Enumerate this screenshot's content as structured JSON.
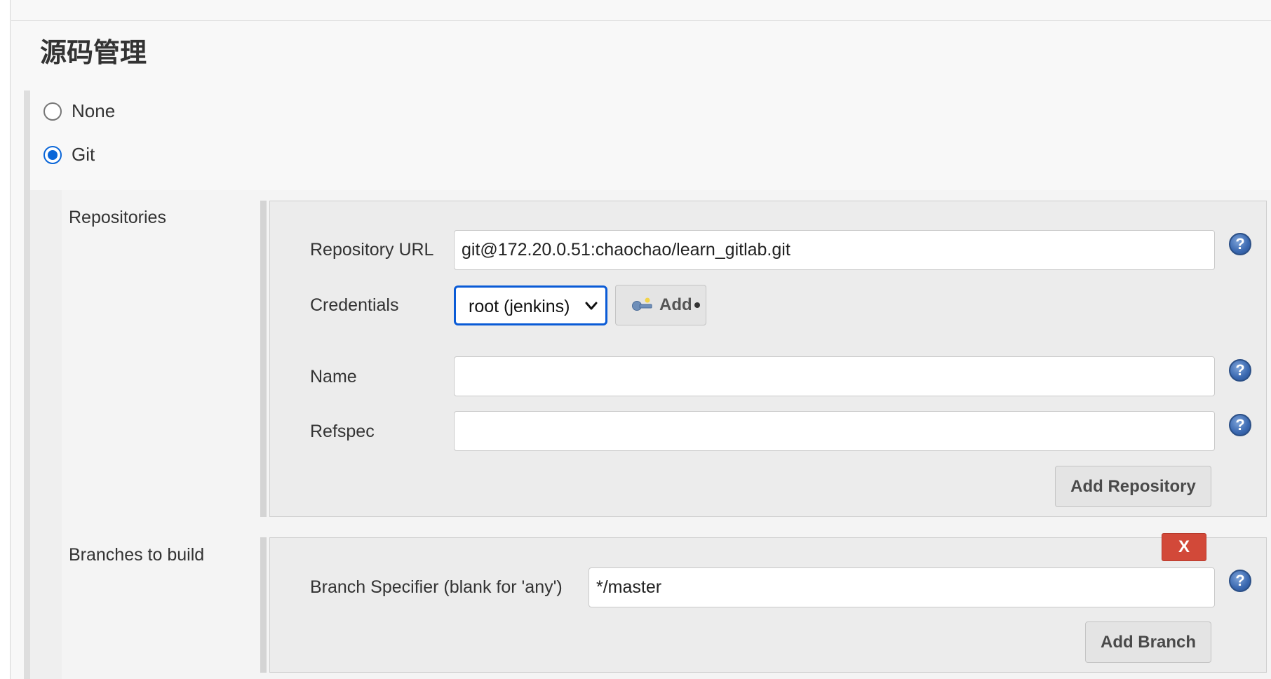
{
  "section": {
    "title": "源码管理"
  },
  "scm": {
    "options": [
      {
        "label": "None",
        "checked": false
      },
      {
        "label": "Git",
        "checked": true
      }
    ]
  },
  "repositories": {
    "section_label": "Repositories",
    "url_label": "Repository URL",
    "url_value": "git@172.20.0.51:chaochao/learn_gitlab.git",
    "credentials_label": "Credentials",
    "credentials_selected": "root (jenkins)",
    "add_credentials_label": "Add",
    "name_label": "Name",
    "name_value": "",
    "refspec_label": "Refspec",
    "refspec_value": "",
    "add_repository_label": "Add Repository"
  },
  "branches": {
    "section_label": "Branches to build",
    "delete_label": "X",
    "specifier_label": "Branch Specifier (blank for 'any')",
    "specifier_value": "*/master",
    "add_branch_label": "Add Branch"
  },
  "help_icon": {
    "glyph": "?"
  },
  "colors": {
    "accent": "#0a5bd6",
    "danger": "#d24939"
  }
}
